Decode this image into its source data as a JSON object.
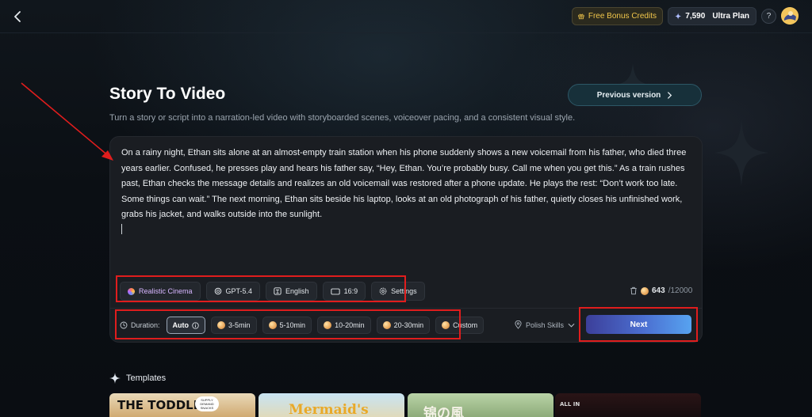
{
  "topbar": {
    "bonus_label": "Free Bonus Credits",
    "credits": "7,590",
    "plan": "Ultra Plan",
    "help": "?"
  },
  "header": {
    "title": "Story To Video",
    "subtitle": "Turn a story or script into a narration-led video with storyboarded scenes, voiceover pacing, and a consistent visual style.",
    "previous_version": "Previous version"
  },
  "editor": {
    "story": "On a rainy night, Ethan sits alone at an almost-empty train station when his phone suddenly shows a new voicemail from his father, who died three years earlier. Confused, he presses play and hears his father say, “Hey, Ethan. You’re probably busy. Call me when you get this.” As a train rushes past, Ethan checks the message details and realizes an old voicemail was restored after a phone update. He plays the rest: “Don’t work too late. Some things can wait.” The next morning, Ethan sits beside his laptop, looks at an old photograph of his father, quietly closes his unfinished work, grabs his jacket, and walks outside into the sunlight.",
    "chips": {
      "style": "Realistic Cinema",
      "model": "GPT-5.4",
      "language": "English",
      "ratio": "16:9",
      "settings": "Settings"
    },
    "char_count": "643",
    "char_max": "/12000"
  },
  "duration": {
    "label": "Duration:",
    "options": [
      "Auto",
      "3-5min",
      "5-10min",
      "10-20min",
      "20-30min",
      "Custom"
    ],
    "selected": "Auto"
  },
  "polish_skills": "Polish Skills",
  "next_label": "Next",
  "templates": {
    "heading": "Templates",
    "items": [
      {
        "title": "THE TODDLER",
        "badge": "SUPPLY DEMAND SNACKS"
      },
      {
        "title": "Mermaid's"
      },
      {
        "title": "锦の風"
      },
      {
        "title": "ALL IN"
      }
    ]
  },
  "colors": {
    "accent_gold": "#f1c64b",
    "next_gradient_start": "#3c3f9a",
    "next_gradient_end": "#57a3f0",
    "annotation_red": "#e01d1d"
  }
}
